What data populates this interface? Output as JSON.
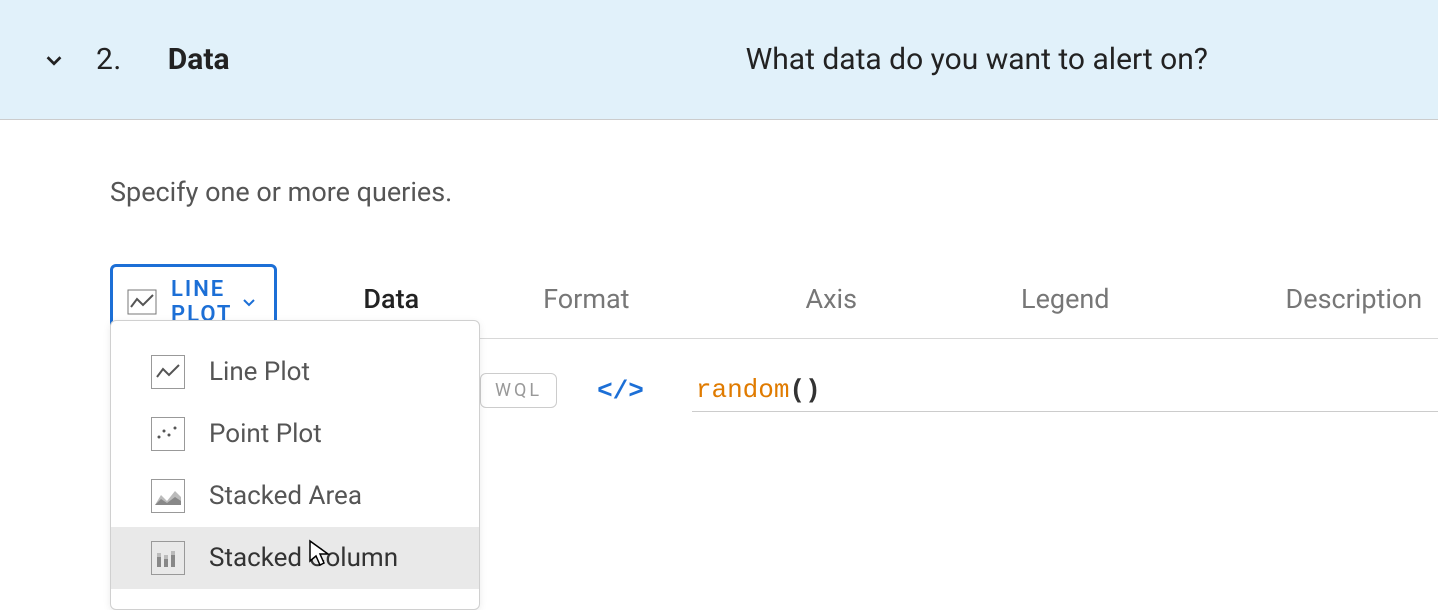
{
  "header": {
    "step_number": "2.",
    "step_title": "Data",
    "question": "What data do you want to alert on?"
  },
  "instruction": "Specify one or more queries.",
  "plot_selector": {
    "label": "LINE PLOT"
  },
  "tabs": {
    "data": "Data",
    "format": "Format",
    "axis": "Axis",
    "legend": "Legend",
    "description": "Description"
  },
  "query": {
    "wql_label": "WQL",
    "function": "random",
    "parens": "()"
  },
  "dropdown": {
    "items": [
      {
        "label": "Line Plot"
      },
      {
        "label": "Point Plot"
      },
      {
        "label": "Stacked Area"
      },
      {
        "label": "Stacked Column"
      }
    ]
  }
}
